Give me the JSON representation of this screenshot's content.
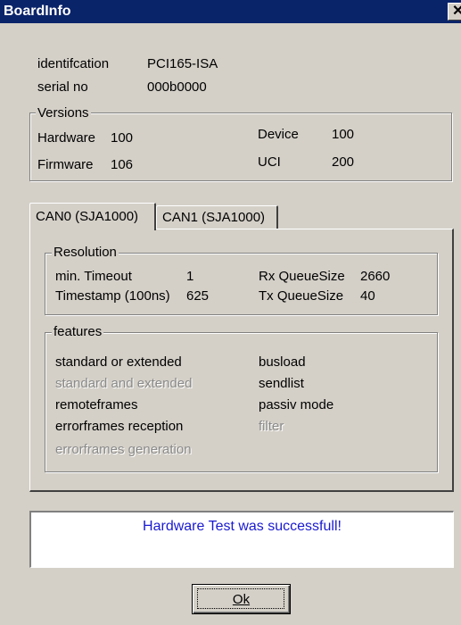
{
  "window": {
    "title": "BoardInfo",
    "close_glyph": "✕"
  },
  "board": {
    "identification_label": "identifcation",
    "identification_value": "PCI165-ISA",
    "serial_label": "serial no",
    "serial_value": "000b0000"
  },
  "versions": {
    "legend": "Versions",
    "hardware_label": "Hardware",
    "hardware_value": "100",
    "firmware_label": "Firmware",
    "firmware_value": "106",
    "device_label": "Device",
    "device_value": "100",
    "uci_label": "UCI",
    "uci_value": "200"
  },
  "tabs": [
    {
      "label": "CAN0 (SJA1000)",
      "selected": true
    },
    {
      "label": "CAN1 (SJA1000)",
      "selected": false
    }
  ],
  "resolution": {
    "legend": "Resolution",
    "min_timeout_label": "min. Timeout",
    "min_timeout_value": "1",
    "timestamp_label": "Timestamp (100ns)",
    "timestamp_value": "625",
    "rx_queue_label": "Rx QueueSize",
    "rx_queue_value": "2660",
    "tx_queue_label": "Tx QueueSize",
    "tx_queue_value": "40"
  },
  "features": {
    "legend": "features",
    "left": [
      {
        "label": "standard or extended",
        "enabled": true
      },
      {
        "label": "standard and extended",
        "enabled": false
      },
      {
        "label": "remoteframes",
        "enabled": true
      },
      {
        "label": "errorframes reception",
        "enabled": true
      },
      {
        "label": "errorframes generation",
        "enabled": false
      }
    ],
    "right": [
      {
        "label": "busload",
        "enabled": true
      },
      {
        "label": "sendlist",
        "enabled": true
      },
      {
        "label": "passiv mode",
        "enabled": true
      },
      {
        "label": "filter",
        "enabled": false
      }
    ]
  },
  "status": {
    "message": "Hardware Test was successfull!",
    "color": "#1a1ad0"
  },
  "buttons": {
    "ok_label": "Ok"
  },
  "colors": {
    "titlebar": "#0a246a",
    "dialog_face": "#d4d0c8",
    "disabled_text": "#8a8a8a"
  }
}
